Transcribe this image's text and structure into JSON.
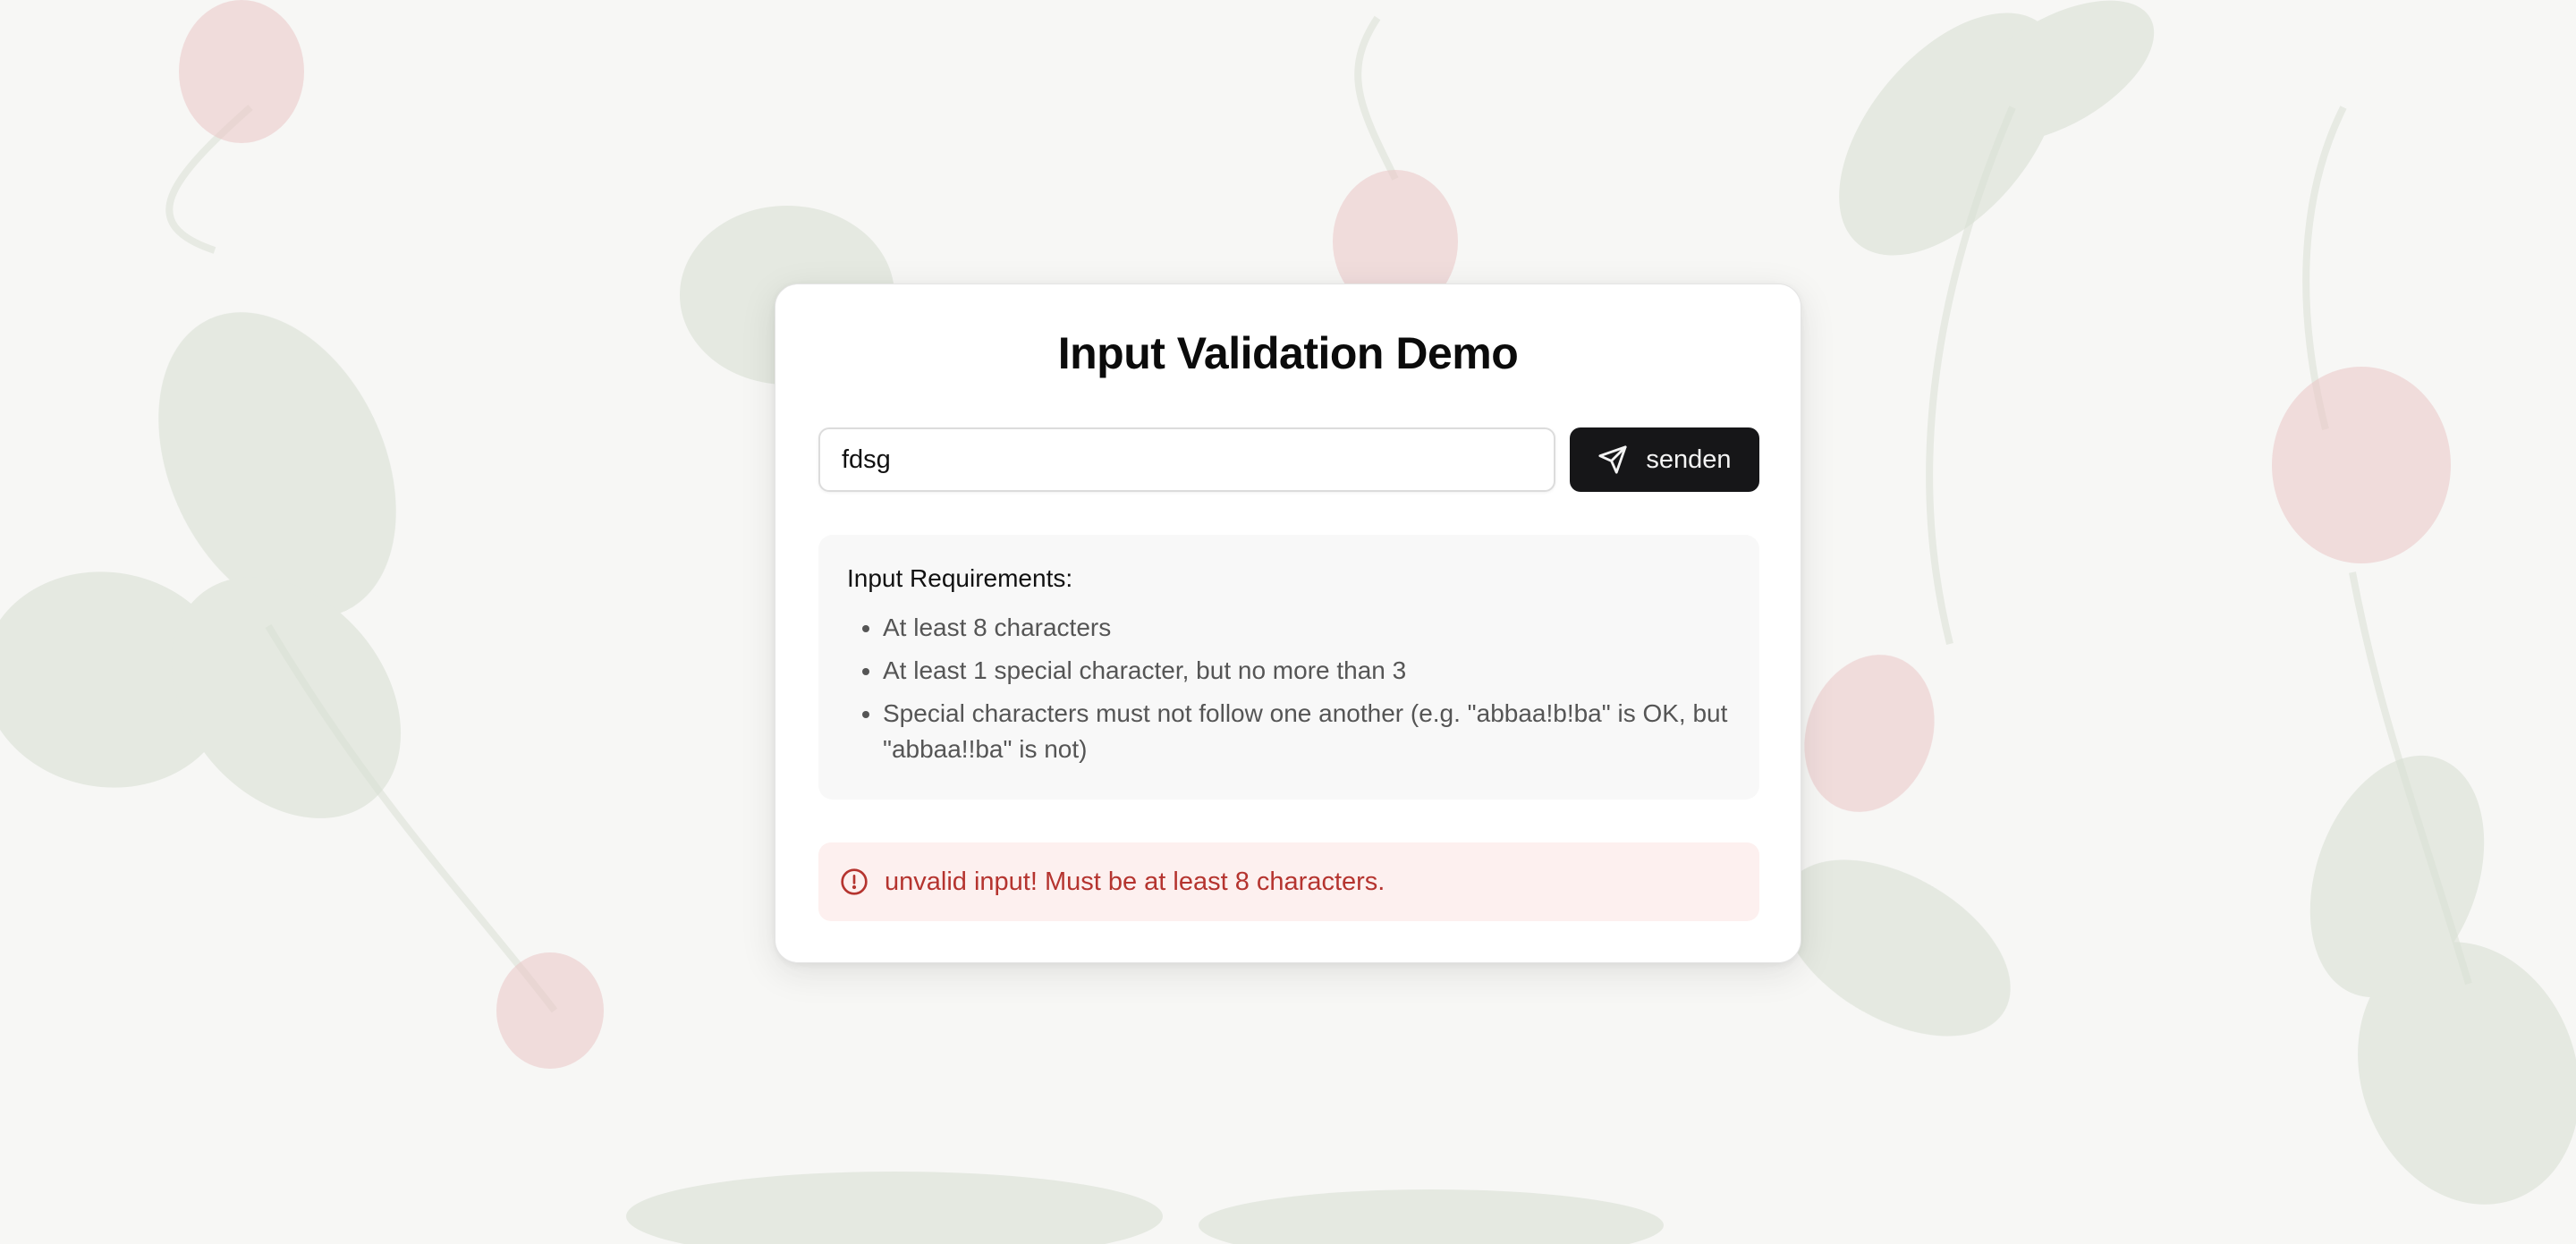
{
  "page": {
    "title": "Input Validation Demo"
  },
  "form": {
    "input_value": "fdsg",
    "input_icon": "send-icon",
    "submit_label": "senden"
  },
  "requirements": {
    "heading": "Input Requirements:",
    "items": [
      "At least 8 characters",
      "At least 1 special character, but no more than 3",
      "Special characters must not follow one another (e.g. \"abbaa!b!ba\" is OK, but \"abbaa!!ba\" is not)"
    ]
  },
  "error": {
    "icon": "alert-circle-icon",
    "message": "unvalid input! Must be at least 8 characters."
  },
  "colors": {
    "button_bg": "#161618",
    "error_text": "#b5342f",
    "error_bg": "#fdf0ef",
    "requirements_bg": "#f8f8f8",
    "card_bg": "#ffffff"
  },
  "background": {
    "description_icon": "radish-background-image"
  }
}
